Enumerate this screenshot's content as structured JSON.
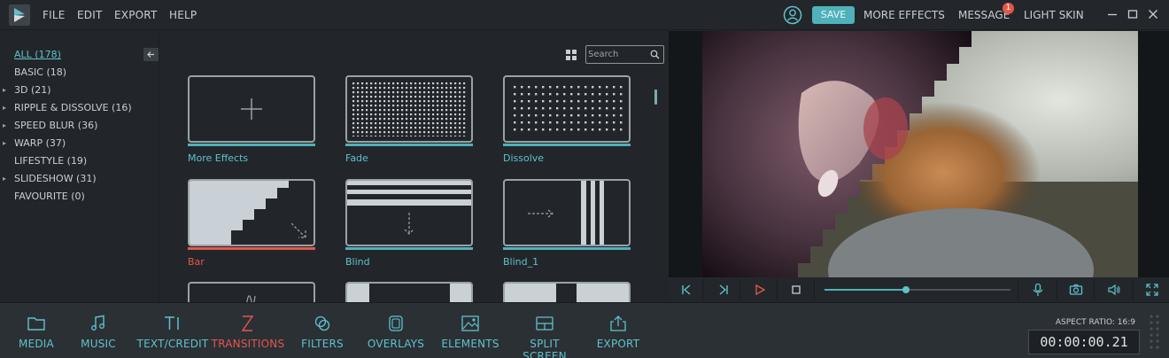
{
  "menu": [
    "FILE",
    "EDIT",
    "EXPORT",
    "HELP"
  ],
  "header": {
    "save_label": "SAVE",
    "more_effects_label": "MORE EFFECTS",
    "message_label": "MESSAGE",
    "message_badge": "1",
    "light_skin_label": "LIGHT SKIN"
  },
  "categories": [
    {
      "label": "ALL (178)",
      "active": true,
      "expandable": false
    },
    {
      "label": "BASIC (18)",
      "expandable": false
    },
    {
      "label": "3D (21)",
      "expandable": true
    },
    {
      "label": "RIPPLE & DISSOLVE (16)",
      "expandable": true
    },
    {
      "label": "SPEED BLUR (36)",
      "expandable": true
    },
    {
      "label": "WARP (37)",
      "expandable": true
    },
    {
      "label": "LIFESTYLE (19)",
      "expandable": false
    },
    {
      "label": "SLIDESHOW (31)",
      "expandable": true
    },
    {
      "label": "FAVOURITE (0)",
      "expandable": false
    }
  ],
  "search": {
    "placeholder": "Search"
  },
  "effects": [
    {
      "label": "More Effects",
      "thumb": "plus"
    },
    {
      "label": "Fade",
      "thumb": "dots-dense"
    },
    {
      "label": "Dissolve",
      "thumb": "dots-sparse"
    },
    {
      "label": "Bar",
      "thumb": "stairs",
      "selected": true
    },
    {
      "label": "Blind",
      "thumb": "blind-horizontal"
    },
    {
      "label": "Blind_1",
      "thumb": "blind-vertical"
    },
    {
      "label": "",
      "thumb": "wave"
    },
    {
      "label": "",
      "thumb": "panels"
    },
    {
      "label": "",
      "thumb": "panels-2"
    }
  ],
  "player": {
    "progress": 0.44
  },
  "bottom_nav": [
    {
      "label": "MEDIA",
      "icon": "folder-icon"
    },
    {
      "label": "MUSIC",
      "icon": "music-icon"
    },
    {
      "label": "TEXT/CREDIT",
      "icon": "text-icon"
    },
    {
      "label": "TRANSITIONS",
      "icon": "transitions-icon",
      "active": true
    },
    {
      "label": "FILTERS",
      "icon": "filters-icon"
    },
    {
      "label": "OVERLAYS",
      "icon": "overlays-icon"
    },
    {
      "label": "ELEMENTS",
      "icon": "elements-icon"
    },
    {
      "label": "SPLIT SCREEN",
      "icon": "split-screen-icon"
    },
    {
      "label": "EXPORT",
      "icon": "export-icon"
    }
  ],
  "aspect_ratio_label": "ASPECT RATIO: 16:9",
  "timecode": "00:00:00.21",
  "colors": {
    "accent": "#4fb1bb",
    "active": "#e2574c",
    "background": "#22262a"
  }
}
